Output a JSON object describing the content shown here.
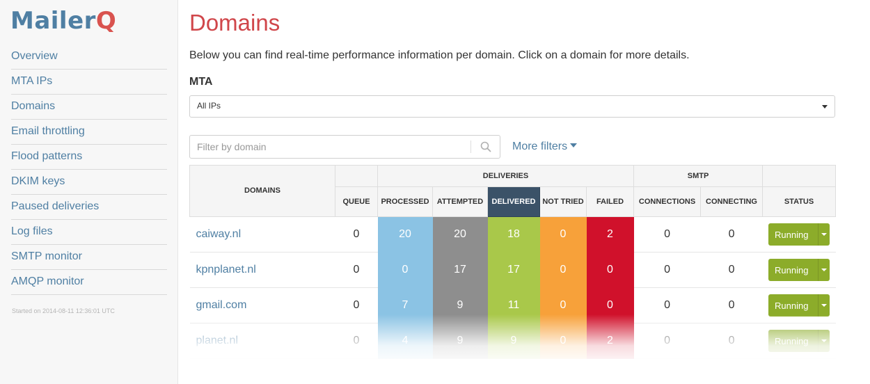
{
  "app": {
    "logo_main": "Mailer",
    "logo_accent": "Q"
  },
  "sidebar": {
    "items": [
      {
        "label": "Overview"
      },
      {
        "label": "MTA IPs"
      },
      {
        "label": "Domains"
      },
      {
        "label": "Email throttling"
      },
      {
        "label": "Flood patterns"
      },
      {
        "label": "DKIM keys"
      },
      {
        "label": "Paused deliveries"
      },
      {
        "label": "Log files"
      },
      {
        "label": "SMTP monitor"
      },
      {
        "label": "AMQP monitor"
      }
    ],
    "started": "Started on 2014-08-11 12:36:01 UTC"
  },
  "page": {
    "title": "Domains",
    "intro": "Below you can find real-time performance information per domain. Click on a domain for more details.",
    "mta_label": "MTA",
    "mta_selected": "All IPs",
    "filter_placeholder": "Filter by domain",
    "more_filters": "More filters"
  },
  "table": {
    "groups": {
      "domains": "DOMAINS",
      "deliveries": "DELIVERIES",
      "smtp": "SMTP"
    },
    "columns": {
      "queue": "QUEUE",
      "processed": "PROCESSED",
      "attempted": "ATTEMPTED",
      "delivered": "DELIVERED",
      "not_tried": "NOT TRIED",
      "failed": "FAILED",
      "connections": "CONNECTIONS",
      "connecting": "CONNECTING",
      "status": "STATUS"
    },
    "rows": [
      {
        "domain": "caiway.nl",
        "queue": "0",
        "processed": "20",
        "attempted": "20",
        "delivered": "18",
        "not_tried": "0",
        "failed": "2",
        "connections": "0",
        "connecting": "0",
        "status": "Running"
      },
      {
        "domain": "kpnplanet.nl",
        "queue": "0",
        "processed": "0",
        "attempted": "17",
        "delivered": "17",
        "not_tried": "0",
        "failed": "0",
        "connections": "0",
        "connecting": "0",
        "status": "Running"
      },
      {
        "domain": "gmail.com",
        "queue": "0",
        "processed": "7",
        "attempted": "9",
        "delivered": "11",
        "not_tried": "0",
        "failed": "0",
        "connections": "0",
        "connecting": "0",
        "status": "Running"
      },
      {
        "domain": "planet.nl",
        "queue": "0",
        "processed": "4",
        "attempted": "9",
        "delivered": "9",
        "not_tried": "0",
        "failed": "2",
        "connections": "0",
        "connecting": "0",
        "status": "Running"
      }
    ]
  },
  "colors": {
    "brand": "#4f7fa3",
    "title": "#d0464a",
    "processed": "#8bc3e4",
    "attempted": "#8e8e8e",
    "delivered": "#a9c84a",
    "not_tried": "#f7a13a",
    "failed": "#d0112b",
    "status_running": "#8cac2a"
  },
  "icons": {
    "search": "search-icon",
    "mta_caret": "chevron-down-icon",
    "filters_caret": "caret-down-icon",
    "status_caret": "caret-down-icon"
  }
}
